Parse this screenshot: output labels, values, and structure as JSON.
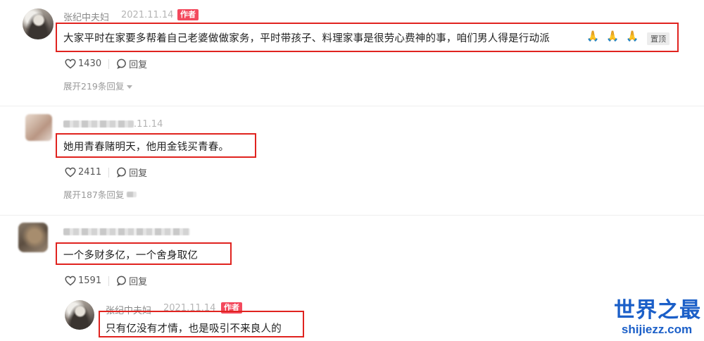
{
  "comments": [
    {
      "author": "张纪中夫妇",
      "date": "2021.11.14",
      "badge": "作者",
      "text": "大家平时在家要多帮着自己老婆做做家务，平时带孩子、料理家事是很劳心费神的事，咱们男人得是行动派",
      "emoji": "🙏🙏🙏",
      "pin_label": "置顶",
      "likes": "1430",
      "reply_label": "回复",
      "expand": "展开219条回复",
      "avatar_icon": "user-avatar-icon"
    },
    {
      "author": "",
      "date": ".11.14",
      "text": "她用青春赌明天，他用金钱买青春。",
      "likes": "2411",
      "reply_label": "回复",
      "expand": "展开187条回复",
      "avatar_icon": "user-avatar-icon"
    },
    {
      "author": "",
      "date": "",
      "text": "一个多财多亿，一个舍身取亿",
      "likes": "1591",
      "reply_label": "回复",
      "avatar_icon": "user-avatar-icon"
    }
  ],
  "reply": {
    "author": "张纪中夫妇",
    "date": "2021.11.14",
    "badge": "作者",
    "text": "只有亿没有才情，也是吸引不来良人的"
  },
  "watermark": {
    "cn": "世界之最",
    "en": "shijiezz.com",
    "color": "#1b5fc8"
  },
  "colors": {
    "highlight_border": "#e0231f",
    "author_badge": "#f3495d"
  },
  "icons": {
    "like": "heart-outline-icon",
    "reply": "chat-bubble-icon",
    "expand": "caret-down-icon"
  }
}
